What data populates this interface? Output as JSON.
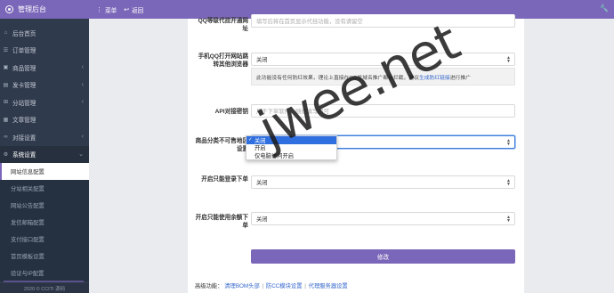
{
  "app": {
    "title": "管理后台"
  },
  "topbar": {
    "menu_label": "菜单",
    "back_label": "返回"
  },
  "sidebar": {
    "items": [
      {
        "label": "后台首页",
        "icon": "home-icon",
        "glyph": "⌂"
      },
      {
        "label": "订单管理",
        "icon": "list-icon",
        "glyph": "☰"
      },
      {
        "label": "商品管理",
        "icon": "cube-icon",
        "glyph": "▣",
        "arrow": "‹"
      },
      {
        "label": "发卡管理",
        "icon": "card-icon",
        "glyph": "▤",
        "arrow": "‹"
      },
      {
        "label": "分站管理",
        "icon": "sitemap-icon",
        "glyph": "⊞",
        "arrow": "‹"
      },
      {
        "label": "文章管理",
        "icon": "file-icon",
        "glyph": "▦"
      },
      {
        "label": "对接设置",
        "icon": "link-icon",
        "glyph": "∞",
        "arrow": "‹"
      },
      {
        "label": "系统设置",
        "icon": "gear-icon",
        "glyph": "⚙",
        "arrow": "⌄"
      }
    ],
    "sub_items": [
      "网站信息配置",
      "分站相关配置",
      "网站公告配置",
      "发信邮箱配置",
      "支付接口配置",
      "首页模板设置",
      "验证与IP配置"
    ],
    "footer": "2020 © CCITI 源码"
  },
  "form": {
    "row1": {
      "label": "QQ等级代挂开通网址",
      "placeholder": "填写后将在首页显示代挂功能，没有请留空"
    },
    "row2": {
      "label": "手机QQ打开网站跳转其他浏览器",
      "value": "关闭",
      "hint_pre": "此功能没有任何防红效果，理论上直接在QQ发域名推广都会拦截，建议",
      "hint_link": "生成防红链接",
      "hint_post": "进行推广"
    },
    "row3": {
      "label": "API对接密钥",
      "placeholder": "用于下单软件，随便填写即可"
    },
    "row4": {
      "label": "商品分类不可售地区设置",
      "value": "关闭",
      "options": [
        "关闭",
        "开启",
        "仅电脑访问开启"
      ]
    },
    "row5": {
      "label": "开启只能登录下单",
      "value": "关闭"
    },
    "row6": {
      "label": "开启只能使用余额下单",
      "value": "关闭"
    },
    "submit_label": "修改",
    "advanced": {
      "label": "高级功能：",
      "links": [
        "清理BOM头部",
        "防CC模块设置",
        "代理服务器设置"
      ]
    }
  },
  "watermark": "jwee.net"
}
